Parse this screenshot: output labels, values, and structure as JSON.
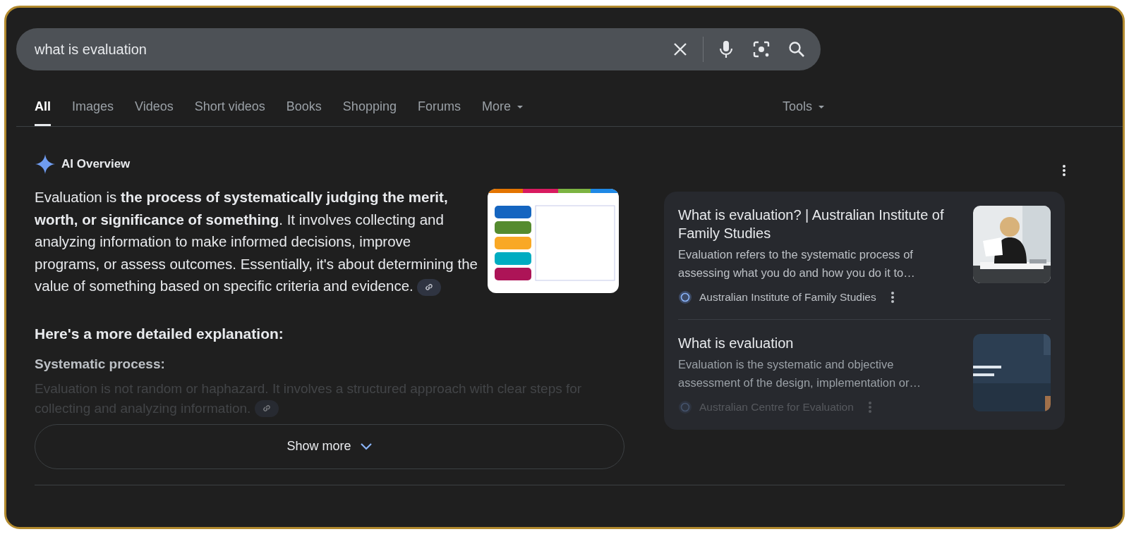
{
  "search": {
    "value": "what is evaluation"
  },
  "tabs": [
    {
      "label": "All",
      "selected": true,
      "dropdown": false
    },
    {
      "label": "Images",
      "selected": false,
      "dropdown": false
    },
    {
      "label": "Videos",
      "selected": false,
      "dropdown": false
    },
    {
      "label": "Short videos",
      "selected": false,
      "dropdown": false
    },
    {
      "label": "Books",
      "selected": false,
      "dropdown": false
    },
    {
      "label": "Shopping",
      "selected": false,
      "dropdown": false
    },
    {
      "label": "Forums",
      "selected": false,
      "dropdown": false
    },
    {
      "label": "More",
      "selected": false,
      "dropdown": true
    }
  ],
  "tools": {
    "label": "Tools"
  },
  "ai_overview": {
    "title": "AI Overview",
    "summary": "Evaluation is **the process of systematically judging the merit, worth, or significance of something**. It involves collecting and analyzing information to make informed decisions, improve programs, or assess outcomes. Essentially, it's about determining the value of something based on specific criteria and evidence.",
    "heading": "Here's a more detailed explanation:",
    "points": [
      {
        "title": "Systematic process:",
        "text": "Evaluation is not random or haphazard. It involves a structured approach with clear steps for collecting and analyzing information."
      }
    ],
    "show_more": "Show more",
    "sources": [
      {
        "title": "What is evaluation? | Australian Institute of Family Studies",
        "snippet": "Evaluation refers to the systematic process of assessing what you do and how you do it to…",
        "site": "Australian Institute of Family Studies",
        "faded": false
      },
      {
        "title": "What is evaluation",
        "snippet": "Evaluation is the systematic and objective assessment of the design, implementation or…",
        "site": "Australian Centre for Evaluation",
        "faded": true
      }
    ]
  }
}
